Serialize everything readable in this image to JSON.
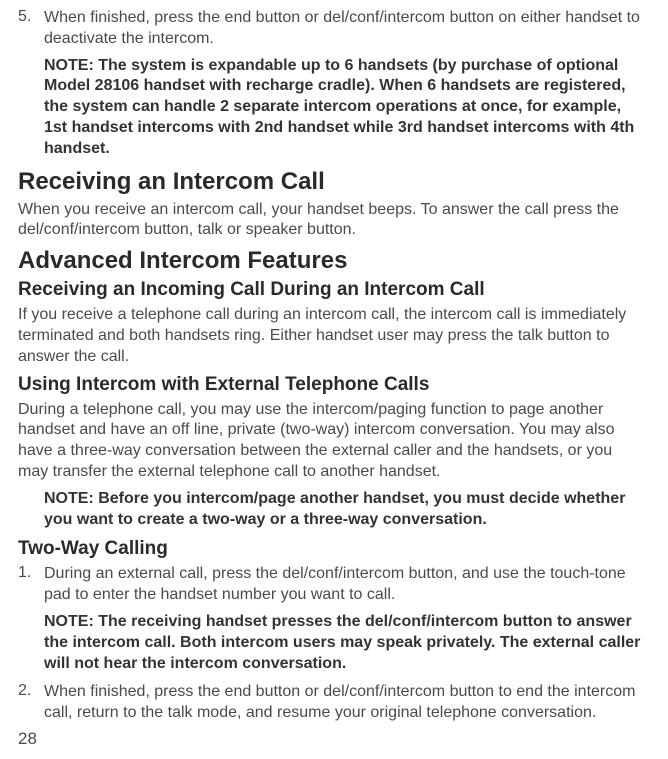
{
  "item5": {
    "num": "5.",
    "text": "When finished, press the end button or del/conf/intercom button on either handset to deactivate the intercom.",
    "note": "NOTE: The system is expandable up to 6 handsets (by purchase of optional Model 28106 handset with recharge cradle). When 6 handsets are registered, the system can handle 2 separate intercom operations at once, for example, 1st handset intercoms with 2nd handset while 3rd handset intercoms with 4th handset."
  },
  "section_receiving": {
    "heading": "Receiving an Intercom Call",
    "body": "When you receive an intercom call, your handset beeps. To answer the call press the del/conf/intercom button, talk or speaker button."
  },
  "section_advanced": {
    "heading": "Advanced Intercom Features",
    "sub1_heading": "Receiving an Incoming Call During an Intercom Call",
    "sub1_body": "If you receive a telephone call during an intercom call, the intercom call is immediately terminated and both handsets ring. Either handset user may press the talk button to answer the call.",
    "sub2_heading": "Using Intercom with External Telephone Calls",
    "sub2_body": "During a telephone call, you may use the intercom/paging function to page another handset and have an off line, private (two-way) intercom conversation. You may also have a three-way conversation between the external caller and the handsets, or you may transfer the external telephone call to another handset.",
    "sub2_note": "NOTE: Before you intercom/page another handset, you must decide whether you want to create a two-way or a three-way conversation."
  },
  "section_twoway": {
    "heading": "Two-Way Calling",
    "item1_num": "1.",
    "item1_text": "During an external call, press the del/conf/intercom button, and use the touch-tone pad to enter the handset number you want to call.",
    "item1_note": "NOTE: The receiving handset presses the del/conf/intercom button to answer the intercom call. Both intercom users may speak privately. The external caller will not hear the intercom conversation.",
    "item2_num": "2.",
    "item2_text": "When finished, press the end button or del/conf/intercom button to end the intercom call, return to the talk mode, and resume your original telephone conversation."
  },
  "page_number": "28"
}
